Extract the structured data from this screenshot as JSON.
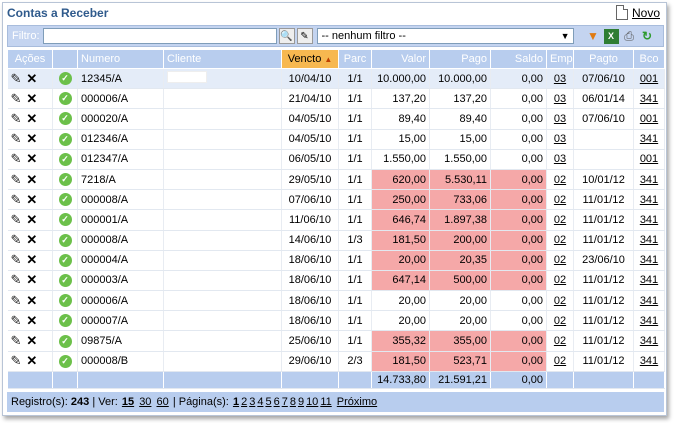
{
  "title": "Contas a Receber",
  "novo_label": "Novo",
  "filter": {
    "label": "Filtro:",
    "value": "",
    "select_value": "-- nenhum filtro --"
  },
  "columns": [
    "Ações",
    "Numero",
    "Cliente",
    "Vencto",
    "Parc",
    "Valor",
    "Pago",
    "Saldo",
    "Emp",
    "Pagto",
    "Bco"
  ],
  "rows": [
    {
      "numero": "12345/A",
      "vencto": "10/04/10",
      "parc": "1/1",
      "valor": "10.000,00",
      "pago": "10.000,00",
      "saldo": "0,00",
      "emp": "03",
      "pagto": "07/06/10",
      "bco": "001",
      "red": false
    },
    {
      "numero": "000006/A",
      "vencto": "21/04/10",
      "parc": "1/1",
      "valor": "137,20",
      "pago": "137,20",
      "saldo": "0,00",
      "emp": "03",
      "pagto": "06/01/14",
      "bco": "341",
      "red": false
    },
    {
      "numero": "000020/A",
      "vencto": "04/05/10",
      "parc": "1/1",
      "valor": "89,40",
      "pago": "89,40",
      "saldo": "0,00",
      "emp": "03",
      "pagto": "07/06/10",
      "bco": "001",
      "red": false
    },
    {
      "numero": "012346/A",
      "vencto": "04/05/10",
      "parc": "1/1",
      "valor": "15,00",
      "pago": "15,00",
      "saldo": "0,00",
      "emp": "03",
      "pagto": "",
      "bco": "341",
      "red": false
    },
    {
      "numero": "012347/A",
      "vencto": "06/05/10",
      "parc": "1/1",
      "valor": "1.550,00",
      "pago": "1.550,00",
      "saldo": "0,00",
      "emp": "03",
      "pagto": "",
      "bco": "001",
      "red": false
    },
    {
      "numero": "7218/A",
      "vencto": "29/05/10",
      "parc": "1/1",
      "valor": "620,00",
      "pago": "5.530,11",
      "saldo": "0,00",
      "emp": "02",
      "pagto": "10/01/12",
      "bco": "341",
      "red": true
    },
    {
      "numero": "000008/A",
      "vencto": "07/06/10",
      "parc": "1/1",
      "valor": "250,00",
      "pago": "733,06",
      "saldo": "0,00",
      "emp": "02",
      "pagto": "11/01/12",
      "bco": "341",
      "red": true
    },
    {
      "numero": "000001/A",
      "vencto": "11/06/10",
      "parc": "1/1",
      "valor": "646,74",
      "pago": "1.897,38",
      "saldo": "0,00",
      "emp": "02",
      "pagto": "11/01/12",
      "bco": "341",
      "red": true
    },
    {
      "numero": "000008/A",
      "vencto": "14/06/10",
      "parc": "1/3",
      "valor": "181,50",
      "pago": "200,00",
      "saldo": "0,00",
      "emp": "02",
      "pagto": "11/01/12",
      "bco": "341",
      "red": true
    },
    {
      "numero": "000004/A",
      "vencto": "18/06/10",
      "parc": "1/1",
      "valor": "20,00",
      "pago": "20,35",
      "saldo": "0,00",
      "emp": "02",
      "pagto": "23/06/10",
      "bco": "341",
      "red": true
    },
    {
      "numero": "000003/A",
      "vencto": "18/06/10",
      "parc": "1/1",
      "valor": "647,14",
      "pago": "500,00",
      "saldo": "0,00",
      "emp": "02",
      "pagto": "11/01/12",
      "bco": "341",
      "red": true
    },
    {
      "numero": "000006/A",
      "vencto": "18/06/10",
      "parc": "1/1",
      "valor": "20,00",
      "pago": "20,00",
      "saldo": "0,00",
      "emp": "02",
      "pagto": "11/01/12",
      "bco": "341",
      "red": false
    },
    {
      "numero": "000007/A",
      "vencto": "18/06/10",
      "parc": "1/1",
      "valor": "20,00",
      "pago": "20,00",
      "saldo": "0,00",
      "emp": "02",
      "pagto": "11/01/12",
      "bco": "341",
      "red": false
    },
    {
      "numero": "09875/A",
      "vencto": "25/06/10",
      "parc": "1/1",
      "valor": "355,32",
      "pago": "355,00",
      "saldo": "0,00",
      "emp": "02",
      "pagto": "11/01/12",
      "bco": "341",
      "red": true
    },
    {
      "numero": "000008/B",
      "vencto": "29/06/10",
      "parc": "2/3",
      "valor": "181,50",
      "pago": "523,71",
      "saldo": "0,00",
      "emp": "02",
      "pagto": "11/01/12",
      "bco": "341",
      "red": true
    }
  ],
  "totals": {
    "valor": "14.733,80",
    "pago": "21.591,21",
    "saldo": "0,00"
  },
  "footer": {
    "registros_label": "Registro(s):",
    "registros": "243",
    "ver_label": "| Ver:",
    "ver_options": [
      "15",
      "30",
      "60"
    ],
    "pagina_label": "| Página(s):",
    "pages": [
      "1",
      "2",
      "3",
      "4",
      "5",
      "6",
      "7",
      "8",
      "9",
      "10",
      "11"
    ],
    "next": "Próximo"
  },
  "colors": {
    "header_bg": "#b8cdee",
    "sorted_bg": "#f7b850",
    "red_cell": "#f5a8a8",
    "title": "#2f5a8c"
  }
}
